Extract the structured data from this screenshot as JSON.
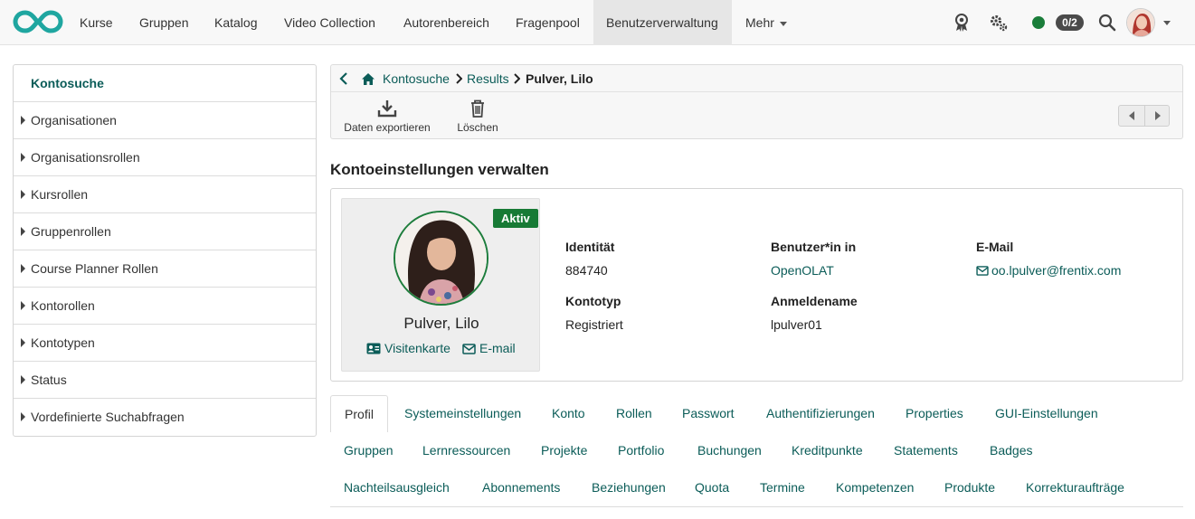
{
  "nav": {
    "items": [
      {
        "label": "Kurse"
      },
      {
        "label": "Gruppen"
      },
      {
        "label": "Katalog"
      },
      {
        "label": "Video Collection"
      },
      {
        "label": "Autorenbereich"
      },
      {
        "label": "Fragenpool"
      },
      {
        "label": "Benutzerverwaltung"
      },
      {
        "label": "Mehr"
      }
    ],
    "session_count": "0/2",
    "status_color": "#1a7d3a"
  },
  "sidebar": {
    "header": "Kontosuche",
    "items": [
      {
        "label": "Organisationen"
      },
      {
        "label": "Organisationsrollen"
      },
      {
        "label": "Kursrollen"
      },
      {
        "label": "Gruppenrollen"
      },
      {
        "label": "Course Planner Rollen"
      },
      {
        "label": "Kontorollen"
      },
      {
        "label": "Kontotypen"
      },
      {
        "label": "Status"
      },
      {
        "label": "Vordefinierte Suchabfragen"
      }
    ]
  },
  "breadcrumb": {
    "home": "Kontosuche",
    "results": "Results",
    "current": "Pulver, Lilo"
  },
  "toolbar": {
    "export_label": "Daten exportieren",
    "delete_label": "Löschen"
  },
  "page": {
    "title": "Kontoeinstellungen verwalten"
  },
  "profile": {
    "status": "Aktiv",
    "name": "Pulver, Lilo",
    "business_card_link": "Visitenkarte",
    "email_link": "E-mail",
    "fields": {
      "identity_label": "Identität",
      "identity_value": "884740",
      "user_in_label": "Benutzer*in in",
      "user_in_value": "OpenOLAT",
      "email_label": "E-Mail",
      "email_value": "oo.lpulver@frentix.com",
      "account_type_label": "Kontotyp",
      "account_type_value": "Registriert",
      "login_label": "Anmeldename",
      "login_value": "lpulver01"
    }
  },
  "tabs": {
    "row1": [
      "Profil",
      "Systemeinstellungen",
      "Konto",
      "Rollen",
      "Passwort",
      "Authentifizierungen",
      "Properties",
      "GUI-Einstellungen"
    ],
    "row2": [
      "Gruppen",
      "Lernressourcen",
      "Projekte",
      "Portfolio",
      "Buchungen",
      "Kreditpunkte",
      "Statements",
      "Badges"
    ],
    "row3": [
      "Nachteilsausgleich",
      "Abonnements",
      "Beziehungen",
      "Quota",
      "Termine",
      "Kompetenzen",
      "Produkte",
      "Korrekturaufträge"
    ],
    "active": "Profil"
  },
  "colors": {
    "brand_teal": "#0b5c58",
    "logo": "#1fa6a0",
    "active_green": "#177a35"
  }
}
